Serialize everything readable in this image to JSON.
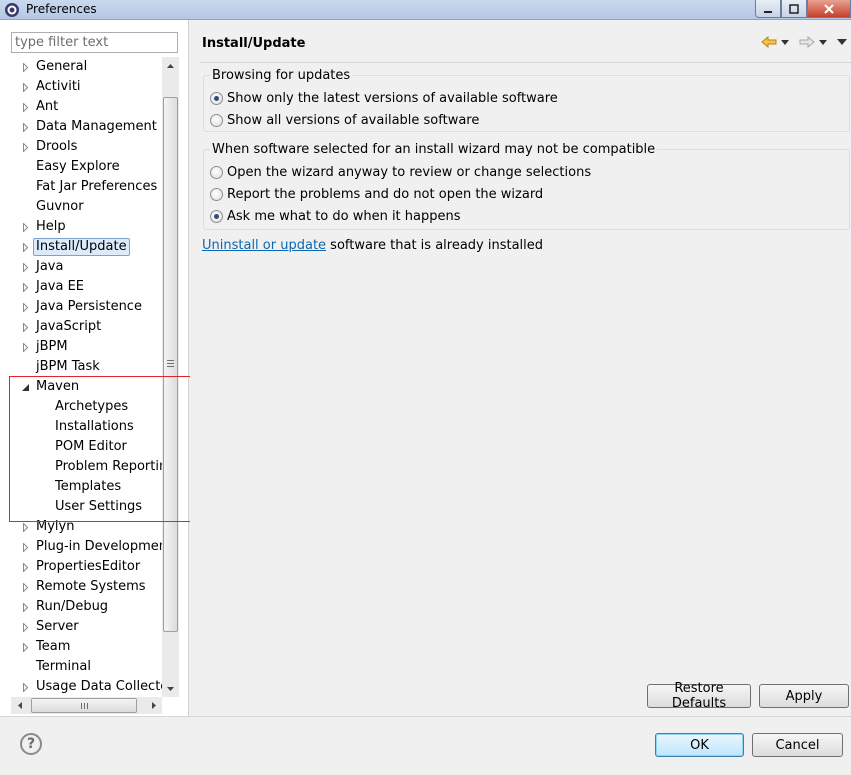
{
  "window": {
    "title": "Preferences"
  },
  "filter": {
    "placeholder": "type filter text"
  },
  "tree": [
    {
      "label": "General",
      "expander": "collapsed",
      "depth": 0
    },
    {
      "label": "Activiti",
      "expander": "collapsed",
      "depth": 0
    },
    {
      "label": "Ant",
      "expander": "collapsed",
      "depth": 0
    },
    {
      "label": "Data Management",
      "expander": "collapsed",
      "depth": 0
    },
    {
      "label": "Drools",
      "expander": "collapsed",
      "depth": 0
    },
    {
      "label": "Easy Explore",
      "expander": "none",
      "depth": 0
    },
    {
      "label": "Fat Jar Preferences",
      "expander": "none",
      "depth": 0
    },
    {
      "label": "Guvnor",
      "expander": "none",
      "depth": 0
    },
    {
      "label": "Help",
      "expander": "collapsed",
      "depth": 0
    },
    {
      "label": "Install/Update",
      "expander": "collapsed",
      "depth": 0,
      "selected": true
    },
    {
      "label": "Java",
      "expander": "collapsed",
      "depth": 0
    },
    {
      "label": "Java EE",
      "expander": "collapsed",
      "depth": 0
    },
    {
      "label": "Java Persistence",
      "expander": "collapsed",
      "depth": 0
    },
    {
      "label": "JavaScript",
      "expander": "collapsed",
      "depth": 0
    },
    {
      "label": "jBPM",
      "expander": "collapsed",
      "depth": 0
    },
    {
      "label": "jBPM Task",
      "expander": "none",
      "depth": 0
    },
    {
      "label": "Maven",
      "expander": "expanded",
      "depth": 0
    },
    {
      "label": "Archetypes",
      "expander": "none",
      "depth": 1
    },
    {
      "label": "Installations",
      "expander": "none",
      "depth": 1
    },
    {
      "label": "POM Editor",
      "expander": "none",
      "depth": 1
    },
    {
      "label": "Problem Reporting",
      "expander": "none",
      "depth": 1
    },
    {
      "label": "Templates",
      "expander": "none",
      "depth": 1
    },
    {
      "label": "User Settings",
      "expander": "none",
      "depth": 1
    },
    {
      "label": "Mylyn",
      "expander": "collapsed",
      "depth": 0
    },
    {
      "label": "Plug-in Development",
      "expander": "collapsed",
      "depth": 0
    },
    {
      "label": "PropertiesEditor",
      "expander": "collapsed",
      "depth": 0
    },
    {
      "label": "Remote Systems",
      "expander": "collapsed",
      "depth": 0
    },
    {
      "label": "Run/Debug",
      "expander": "collapsed",
      "depth": 0
    },
    {
      "label": "Server",
      "expander": "collapsed",
      "depth": 0
    },
    {
      "label": "Team",
      "expander": "collapsed",
      "depth": 0
    },
    {
      "label": "Terminal",
      "expander": "none",
      "depth": 0
    },
    {
      "label": "Usage Data Collector",
      "expander": "collapsed",
      "depth": 0
    }
  ],
  "page": {
    "title": "Install/Update",
    "browsing_group": {
      "title": "Browsing for updates",
      "options": [
        {
          "label": "Show only the latest versions of available software",
          "checked": true
        },
        {
          "label": "Show all versions of available software",
          "checked": false
        }
      ]
    },
    "compat_group": {
      "title": "When software selected for an install wizard may not be compatible",
      "options": [
        {
          "label": "Open the wizard anyway to review or change selections",
          "checked": false
        },
        {
          "label": "Report the problems and do not open the wizard",
          "checked": false
        },
        {
          "label": "Ask me what to do when it happens",
          "checked": true
        }
      ]
    },
    "link_text": "Uninstall or update",
    "link_suffix": " software that is already installed",
    "restore_defaults": "Restore Defaults",
    "apply": "Apply"
  },
  "footer": {
    "help": "?",
    "ok": "OK",
    "cancel": "Cancel"
  },
  "colors": {
    "highlight_box": "#e0252a",
    "selection_bg": "#dcebfc",
    "link": "#0b67b1"
  }
}
